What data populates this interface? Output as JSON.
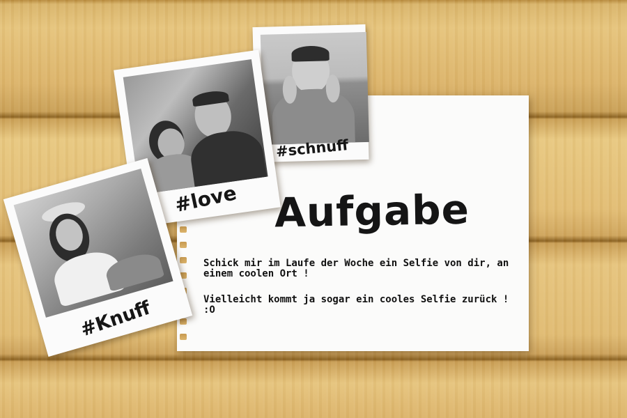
{
  "note": {
    "title": "Aufgabe",
    "paragraph1": "Schick mir im Laufe der Woche ein Selfie von dir, an einem coolen Ort !",
    "paragraph2": "Vielleicht kommt ja sogar ein cooles Selfie zurück ! :O"
  },
  "polaroids": [
    {
      "caption": "#schnuff"
    },
    {
      "caption": "#love"
    },
    {
      "caption": "#Knuff"
    }
  ],
  "colors": {
    "wood": "#e2bd74",
    "paper": "#fbfbfa",
    "ink": "#151515"
  }
}
